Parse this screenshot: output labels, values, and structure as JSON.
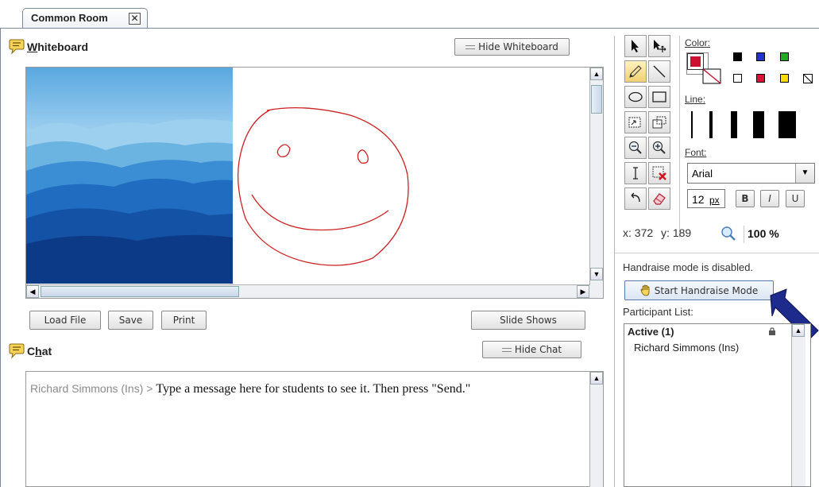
{
  "tab": {
    "title": "Common Room",
    "close": "✕"
  },
  "whiteboard": {
    "title_first": "W",
    "title_rest": "hiteboard",
    "hide_label": "Hide Whiteboard",
    "load_label": "Load File",
    "save_label": "Save",
    "print_label": "Print",
    "slides_label": "Slide Shows"
  },
  "chat": {
    "title_first": "C",
    "title_second": "h",
    "title_rest": "at",
    "hide_label": "Hide Chat",
    "sender": "Richard Simmons (Ins)",
    "separator": " > ",
    "message": "Type a message here for students to see it. Then press \"Send.\""
  },
  "toolbox": {
    "color_label": "Color:",
    "line_label": "Line:",
    "font_label": "Font:",
    "font_value": "Arial",
    "font_size": "12",
    "font_size_unit": "px",
    "bold": "B",
    "italic": "I",
    "underline": "U",
    "colors": [
      "#000000",
      "#2233cc",
      "#22aa22",
      "#ffffff",
      "#dd1133",
      "#ffdd00"
    ],
    "selected_color": "#cc1133",
    "tools": [
      "select-arrow",
      "move-select",
      "pencil",
      "line",
      "ellipse",
      "rectangle",
      "image-insert",
      "copy-object",
      "zoom-out",
      "zoom-in",
      "text-cursor",
      "delete-selection",
      "undo",
      "eraser"
    ]
  },
  "coords": {
    "x_label": "x:",
    "x": "372",
    "y_label": "y:",
    "y": "189",
    "zoom": "100 %"
  },
  "handraise": {
    "status": "Handraise mode is disabled.",
    "start_label": "Start Handraise Mode"
  },
  "participants": {
    "label": "Participant List:",
    "active_header": "Active (1)",
    "items": [
      "Richard Simmons (Ins)"
    ]
  },
  "colors": {
    "drawing": "#cc2222",
    "arrow": "#1e2a8c",
    "frame": "#7a8a99"
  }
}
